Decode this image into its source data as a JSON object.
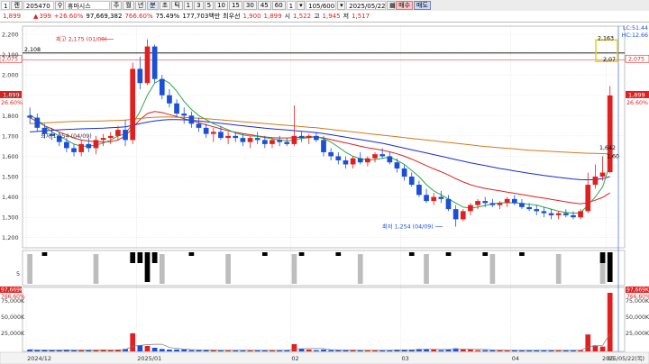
{
  "toolbar": {
    "item1": "1",
    "item2": "켄",
    "code": "205470",
    "search_icon": "search-icon",
    "name": "휴마시스",
    "periods": [
      "주",
      "월",
      "년",
      "분",
      "초",
      "틱"
    ],
    "minutes": [
      "1",
      "3",
      "5",
      "10",
      "15",
      "30",
      "45",
      "60"
    ],
    "num": "1",
    "count": "105/600",
    "date": "2025/05/22",
    "buy": "매수",
    "sell": "매도"
  },
  "quote": {
    "price": "1,899",
    "change": "399",
    "pct": "+26.60%",
    "volume": "97,669,382",
    "vol_pct": "766.60%",
    "ratio": "75.49%",
    "amount": "177,703백만",
    "pref_label": "최우선",
    "bid": "1,900",
    "ask": "1,899",
    "open_label": "시",
    "open": "1,522",
    "high_label": "고",
    "high": "1,945",
    "low_label": "저",
    "low": "1,517"
  },
  "chart_data": {
    "type": "candlestick",
    "x_labels": [
      "2024/12",
      "2025/01",
      "02",
      "03",
      "04",
      "05"
    ],
    "price_axis": {
      "ticks": [
        "2,200",
        "2,100",
        "2,000",
        "1,900",
        "1,800",
        "1,700",
        "1,600",
        "1,500",
        "1,400",
        "1,300",
        "1,200"
      ],
      "ylim": [
        1150,
        2240
      ]
    },
    "right_labels": {
      "lc": "LC:51.44",
      "hc": "HC:12.66",
      "top_val": "2,163",
      "close_mark": "2,07",
      "ma_val": "1,642",
      "ma_val2": "1,60",
      "price": "1,899",
      "pct": "26.60%"
    },
    "left_labels": {
      "price": "1,899",
      "pct": "26.60%"
    },
    "guide_lines": {
      "line1": 2108,
      "line1_label": "2,108",
      "line2": 2075,
      "line2_label": "2,075"
    },
    "annotations": {
      "high": "최고 2,175 (01/09)",
      "low": "최저 1,254 (04/09)",
      "mid": "최저 1,254 (04/09)"
    },
    "candles": [
      [
        1800,
        1840,
        1760,
        1790
      ],
      [
        1790,
        1810,
        1720,
        1740
      ],
      [
        1740,
        1760,
        1690,
        1710
      ],
      [
        1710,
        1740,
        1680,
        1700
      ],
      [
        1700,
        1720,
        1650,
        1670
      ],
      [
        1670,
        1690,
        1620,
        1640
      ],
      [
        1640,
        1660,
        1600,
        1620
      ],
      [
        1620,
        1680,
        1600,
        1660
      ],
      [
        1660,
        1690,
        1620,
        1640
      ],
      [
        1640,
        1700,
        1610,
        1680
      ],
      [
        1680,
        1710,
        1650,
        1690
      ],
      [
        1690,
        1720,
        1660,
        1700
      ],
      [
        1700,
        1750,
        1680,
        1730
      ],
      [
        1730,
        1780,
        1650,
        1680
      ],
      [
        1680,
        2060,
        1660,
        2030
      ],
      [
        2030,
        2090,
        1930,
        1960
      ],
      [
        1960,
        2175,
        1950,
        2140
      ],
      [
        2140,
        2150,
        1960,
        1980
      ],
      [
        1980,
        2000,
        1880,
        1900
      ],
      [
        1900,
        1930,
        1840,
        1860
      ],
      [
        1860,
        1880,
        1790,
        1810
      ],
      [
        1810,
        1840,
        1760,
        1800
      ],
      [
        1800,
        1820,
        1740,
        1760
      ],
      [
        1760,
        1790,
        1720,
        1740
      ],
      [
        1740,
        1760,
        1690,
        1710
      ],
      [
        1710,
        1740,
        1670,
        1720
      ],
      [
        1720,
        1750,
        1680,
        1690
      ],
      [
        1690,
        1720,
        1660,
        1700
      ],
      [
        1700,
        1720,
        1670,
        1690
      ],
      [
        1690,
        1710,
        1650,
        1670
      ],
      [
        1670,
        1700,
        1640,
        1690
      ],
      [
        1690,
        1720,
        1660,
        1680
      ],
      [
        1680,
        1700,
        1640,
        1660
      ],
      [
        1660,
        1690,
        1640,
        1680
      ],
      [
        1680,
        1700,
        1650,
        1670
      ],
      [
        1670,
        1690,
        1650,
        1660
      ],
      [
        1660,
        1850,
        1650,
        1700
      ],
      [
        1700,
        1720,
        1670,
        1690
      ],
      [
        1690,
        1710,
        1660,
        1700
      ],
      [
        1700,
        1720,
        1670,
        1680
      ],
      [
        1680,
        1700,
        1600,
        1620
      ],
      [
        1620,
        1640,
        1580,
        1600
      ],
      [
        1600,
        1620,
        1560,
        1580
      ],
      [
        1580,
        1600,
        1540,
        1560
      ],
      [
        1560,
        1600,
        1540,
        1590
      ],
      [
        1590,
        1620,
        1560,
        1570
      ],
      [
        1570,
        1600,
        1550,
        1590
      ],
      [
        1590,
        1620,
        1570,
        1610
      ],
      [
        1610,
        1640,
        1590,
        1600
      ],
      [
        1600,
        1620,
        1560,
        1570
      ],
      [
        1570,
        1590,
        1520,
        1540
      ],
      [
        1540,
        1560,
        1480,
        1500
      ],
      [
        1500,
        1520,
        1450,
        1460
      ],
      [
        1460,
        1480,
        1400,
        1410
      ],
      [
        1410,
        1440,
        1370,
        1380
      ],
      [
        1380,
        1420,
        1360,
        1400
      ],
      [
        1400,
        1430,
        1370,
        1390
      ],
      [
        1390,
        1410,
        1330,
        1340
      ],
      [
        1340,
        1360,
        1254,
        1290
      ],
      [
        1290,
        1340,
        1280,
        1330
      ],
      [
        1330,
        1370,
        1310,
        1360
      ],
      [
        1360,
        1390,
        1340,
        1380
      ],
      [
        1380,
        1400,
        1350,
        1370
      ],
      [
        1370,
        1390,
        1350,
        1360
      ],
      [
        1360,
        1380,
        1340,
        1370
      ],
      [
        1370,
        1400,
        1350,
        1390
      ],
      [
        1390,
        1410,
        1360,
        1370
      ],
      [
        1370,
        1390,
        1340,
        1350
      ],
      [
        1350,
        1370,
        1330,
        1340
      ],
      [
        1340,
        1360,
        1310,
        1330
      ],
      [
        1330,
        1350,
        1300,
        1320
      ],
      [
        1320,
        1340,
        1290,
        1310
      ],
      [
        1310,
        1330,
        1290,
        1320
      ],
      [
        1320,
        1340,
        1300,
        1310
      ],
      [
        1310,
        1330,
        1290,
        1300
      ],
      [
        1300,
        1340,
        1290,
        1330
      ],
      [
        1330,
        1520,
        1320,
        1460
      ],
      [
        1460,
        1560,
        1440,
        1500
      ],
      [
        1500,
        1600,
        1480,
        1520
      ],
      [
        1522,
        1945,
        1517,
        1899
      ]
    ],
    "ma_series": [
      {
        "color": "#e02020",
        "values": [
          1790,
          1770,
          1750,
          1735,
          1720,
          1705,
          1690,
          1680,
          1675,
          1672,
          1670,
          1672,
          1680,
          1700,
          1740,
          1780,
          1810,
          1820,
          1815,
          1805,
          1795,
          1785,
          1775,
          1765,
          1755,
          1745,
          1735,
          1725,
          1718,
          1712,
          1706,
          1700,
          1695,
          1692,
          1690,
          1690,
          1692,
          1694,
          1695,
          1696,
          1690,
          1682,
          1674,
          1666,
          1658,
          1650,
          1642,
          1636,
          1630,
          1622,
          1612,
          1600,
          1586,
          1570,
          1554,
          1538,
          1524,
          1508,
          1490,
          1474,
          1460,
          1450,
          1442,
          1436,
          1430,
          1424,
          1418,
          1412,
          1406,
          1400,
          1394,
          1388,
          1382,
          1376,
          1370,
          1366,
          1372,
          1384,
          1398,
          1420
        ]
      },
      {
        "color": "#1a2bd6",
        "values": [
          1720,
          1722,
          1725,
          1728,
          1730,
          1732,
          1733,
          1735,
          1736,
          1737,
          1738,
          1740,
          1742,
          1745,
          1752,
          1760,
          1768,
          1774,
          1778,
          1780,
          1780,
          1779,
          1777,
          1774,
          1770,
          1766,
          1762,
          1758,
          1754,
          1750,
          1746,
          1742,
          1738,
          1735,
          1732,
          1729,
          1726,
          1723,
          1720,
          1716,
          1712,
          1706,
          1700,
          1694,
          1688,
          1682,
          1676,
          1670,
          1664,
          1656,
          1648,
          1640,
          1632,
          1624,
          1616,
          1608,
          1600,
          1592,
          1584,
          1576,
          1568,
          1561,
          1554,
          1547,
          1540,
          1534,
          1528,
          1522,
          1516,
          1511,
          1506,
          1501,
          1496,
          1492,
          1488,
          1485,
          1484,
          1486,
          1490,
          1500
        ]
      },
      {
        "color": "#d27a1a",
        "values": [
          1760,
          1762,
          1764,
          1766,
          1768,
          1770,
          1771,
          1772,
          1773,
          1773,
          1774,
          1775,
          1776,
          1778,
          1782,
          1786,
          1790,
          1792,
          1793,
          1793,
          1792,
          1791,
          1789,
          1787,
          1785,
          1782,
          1779,
          1776,
          1773,
          1770,
          1767,
          1764,
          1761,
          1758,
          1755,
          1752,
          1749,
          1746,
          1743,
          1740,
          1736,
          1732,
          1728,
          1724,
          1720,
          1716,
          1712,
          1708,
          1704,
          1700,
          1696,
          1692,
          1688,
          1684,
          1680,
          1676,
          1672,
          1668,
          1664,
          1660,
          1656,
          1652,
          1648,
          1645,
          1642,
          1639,
          1636,
          1633,
          1630,
          1628,
          1626,
          1624,
          1622,
          1620,
          1618,
          1616,
          1615,
          1614,
          1613,
          1612
        ]
      },
      {
        "color": "#2ea84a",
        "values": [
          1805,
          1780,
          1750,
          1720,
          1700,
          1680,
          1660,
          1650,
          1650,
          1655,
          1665,
          1680,
          1700,
          1710,
          1760,
          1820,
          1900,
          1960,
          1980,
          1960,
          1920,
          1870,
          1830,
          1800,
          1780,
          1760,
          1745,
          1730,
          1715,
          1705,
          1700,
          1698,
          1692,
          1686,
          1680,
          1676,
          1680,
          1688,
          1692,
          1696,
          1686,
          1670,
          1646,
          1620,
          1600,
          1588,
          1582,
          1584,
          1590,
          1596,
          1580,
          1560,
          1530,
          1500,
          1460,
          1430,
          1410,
          1390,
          1370,
          1350,
          1345,
          1350,
          1358,
          1366,
          1370,
          1372,
          1370,
          1368,
          1364,
          1360,
          1350,
          1340,
          1330,
          1324,
          1320,
          1322,
          1360,
          1400,
          1450,
          1560
        ]
      }
    ],
    "volume_axis": {
      "ticks": [
        "75,000K",
        "50,000K",
        "25,000K"
      ],
      "top": "97,669K",
      "pct": "766.60%"
    },
    "volumes": [
      3,
      2,
      2,
      2,
      2,
      3,
      2,
      2,
      2,
      2,
      3,
      2,
      3,
      4,
      30,
      10,
      9,
      6,
      4,
      3,
      3,
      3,
      2,
      2,
      2,
      2,
      2,
      2,
      2,
      2,
      2,
      2,
      2,
      2,
      2,
      2,
      12,
      4,
      3,
      2,
      3,
      2,
      2,
      2,
      2,
      2,
      2,
      2,
      2,
      2,
      3,
      3,
      3,
      4,
      4,
      3,
      2,
      3,
      5,
      4,
      3,
      2,
      2,
      2,
      2,
      2,
      2,
      2,
      2,
      2,
      2,
      2,
      2,
      2,
      2,
      2,
      28,
      10,
      8,
      97
    ],
    "osc_axis": {
      "tick": "5"
    },
    "x_end": "2025/05/22(목)"
  }
}
